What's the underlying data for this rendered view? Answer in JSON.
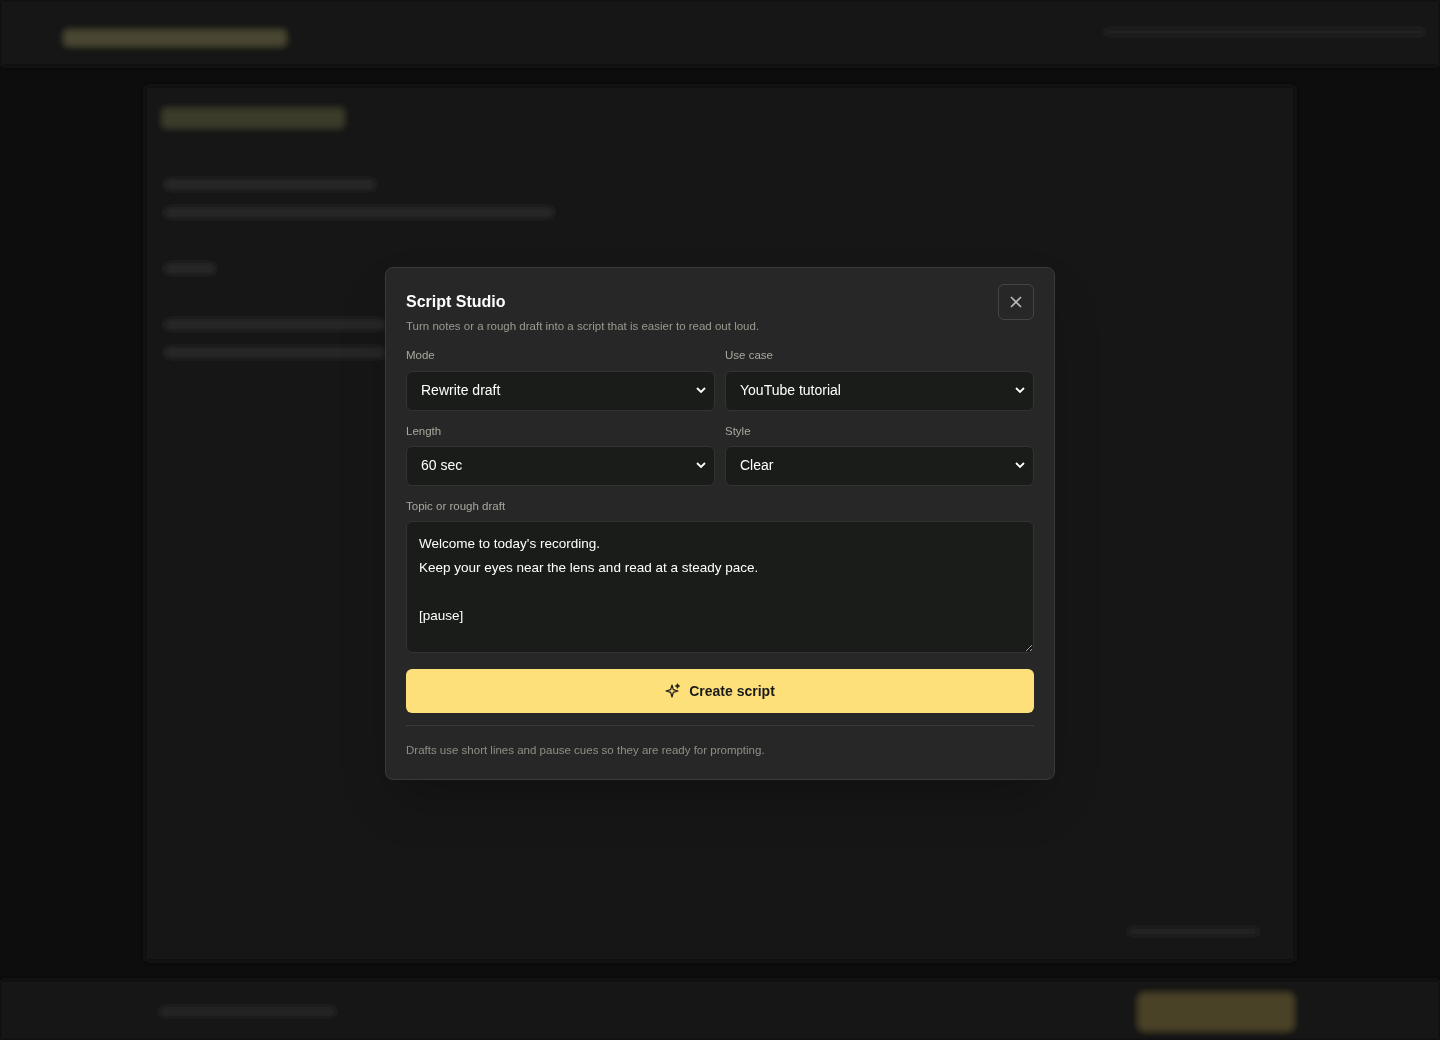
{
  "dialog": {
    "title": "Script Studio",
    "subtitle": "Turn notes or a rough draft into a script that is easier to read out loud.",
    "fields": [
      {
        "kind": "select",
        "label": "Mode",
        "value": "Rewrite draft"
      },
      {
        "kind": "select",
        "label": "Use case",
        "value": "YouTube tutorial"
      },
      {
        "kind": "select",
        "label": "Length",
        "value": "60 sec"
      },
      {
        "kind": "select",
        "label": "Style",
        "value": "Clear"
      }
    ],
    "draft": {
      "label": "Topic or rough draft",
      "paragraphs": [
        [
          "Welcome to today's recording.",
          "Keep your eyes near the lens and read at a steady pace."
        ],
        [
          "[pause]"
        ]
      ]
    },
    "action": "Create script",
    "footnote": "Drafts use short lines and pause cues so they are ready for prompting."
  }
}
